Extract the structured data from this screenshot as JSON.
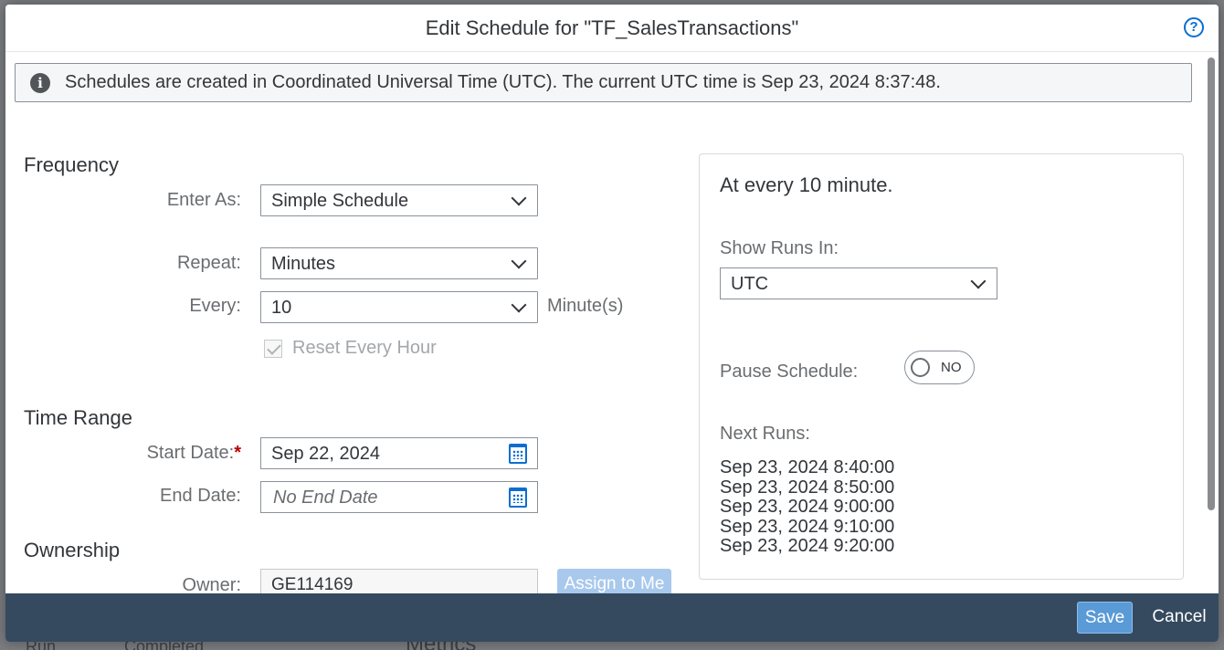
{
  "background": {
    "bottom_left": "Run",
    "bottom_mid": "Completed",
    "bottom_metrics": "Metrics"
  },
  "dialog": {
    "title": "Edit Schedule for \"TF_SalesTransactions\"",
    "help_icon": "?"
  },
  "info": {
    "icon": "i",
    "text": "Schedules are created in Coordinated Universal Time (UTC). The current UTC time is Sep 23, 2024 8:37:48."
  },
  "frequency": {
    "title": "Frequency",
    "enter_as_label": "Enter As:",
    "enter_as_value": "Simple Schedule",
    "repeat_label": "Repeat:",
    "repeat_value": "Minutes",
    "every_label": "Every:",
    "every_value": "10",
    "every_unit": "Minute(s)",
    "reset_label": "Reset Every Hour",
    "reset_checked": true
  },
  "time_range": {
    "title": "Time Range",
    "start_label": "Start Date:",
    "required_marker": "*",
    "start_value": "Sep 22, 2024",
    "end_label": "End Date:",
    "end_placeholder": "No End Date"
  },
  "ownership": {
    "title": "Ownership",
    "owner_label": "Owner:",
    "owner_value": "GE114169",
    "assign_button": "Assign to Me"
  },
  "summary": {
    "title": "At every 10 minute.",
    "show_runs_label": "Show Runs In:",
    "show_runs_value": "UTC",
    "pause_label": "Pause Schedule:",
    "pause_state": "NO",
    "next_runs_label": "Next Runs:",
    "next_runs": [
      "Sep 23, 2024 8:40:00",
      "Sep 23, 2024 8:50:00",
      "Sep 23, 2024 9:00:00",
      "Sep 23, 2024 9:10:00",
      "Sep 23, 2024 9:20:00"
    ]
  },
  "footer": {
    "save_label": "Save",
    "cancel_label": "Cancel"
  }
}
